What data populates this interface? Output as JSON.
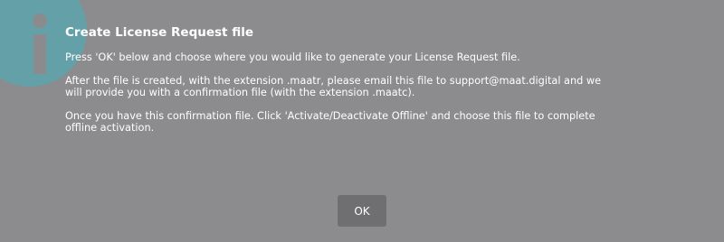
{
  "dialog": {
    "icon": "info-icon",
    "title": "Create License Request file",
    "paragraphs": [
      "Press 'OK' below and choose where you would like to generate your License Request file.",
      "After the file is created, with the extension .maatr, please email this file to support@maat.digital and we\nwill provide you with a confirmation file (with the extension .maatc).",
      "Once you have this confirmation file. Click 'Activate/Deactivate Offline' and choose this file to complete\noffline activation."
    ],
    "ok_label": "OK"
  },
  "colors": {
    "background": "#8c8b8d",
    "badge": "#5fa3ab",
    "button": "#6f6e70",
    "text": "#ffffff"
  }
}
